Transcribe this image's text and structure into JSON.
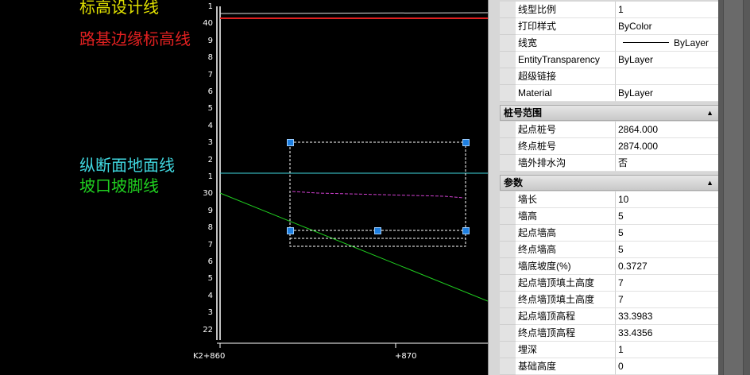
{
  "canvas": {
    "legend": [
      {
        "text": "标高设计线",
        "color": "#e0e000"
      },
      {
        "text": "路基边缘标高线",
        "color": "#e02020"
      },
      {
        "text": "纵断面地面线",
        "color": "#40d8e0"
      },
      {
        "text": "坡口坡脚线",
        "color": "#20d020"
      }
    ],
    "y_ticks": [
      "1",
      "40",
      "9",
      "8",
      "7",
      "6",
      "5",
      "4",
      "3",
      "2",
      "1",
      "30",
      "9",
      "8",
      "7",
      "6",
      "5",
      "4",
      "3",
      "22"
    ],
    "x_ticks": [
      "K2+860",
      "+870"
    ]
  },
  "properties": {
    "top_rows": [
      {
        "key": "线型比例",
        "value": "1"
      },
      {
        "key": "打印样式",
        "value": "ByColor"
      },
      {
        "key": "线宽",
        "value": "ByLayer"
      },
      {
        "key": "EntityTransparency",
        "value": "ByLayer"
      },
      {
        "key": "超级链接",
        "value": ""
      },
      {
        "key": "Material",
        "value": "ByLayer"
      }
    ],
    "section_range": {
      "title": "桩号范围",
      "rows": [
        {
          "key": "起点桩号",
          "value": "2864.000"
        },
        {
          "key": "终点桩号",
          "value": "2874.000"
        },
        {
          "key": "墙外排水沟",
          "value": "否"
        }
      ]
    },
    "section_params": {
      "title": "参数",
      "rows": [
        {
          "key": "墙长",
          "value": "10"
        },
        {
          "key": "墙高",
          "value": "5"
        },
        {
          "key": "起点墙高",
          "value": "5"
        },
        {
          "key": "终点墙高",
          "value": "5"
        },
        {
          "key": "墙底坡度(%)",
          "value": "0.3727"
        },
        {
          "key": "起点墙顶填土高度",
          "value": "7"
        },
        {
          "key": "终点墙顶填土高度",
          "value": "7"
        },
        {
          "key": "起点墙顶高程",
          "value": "33.3983"
        },
        {
          "key": "终点墙顶高程",
          "value": "33.4356"
        },
        {
          "key": "埋深",
          "value": "1"
        },
        {
          "key": "基础高度",
          "value": "0"
        }
      ]
    },
    "collapse_arrow": "▲"
  }
}
